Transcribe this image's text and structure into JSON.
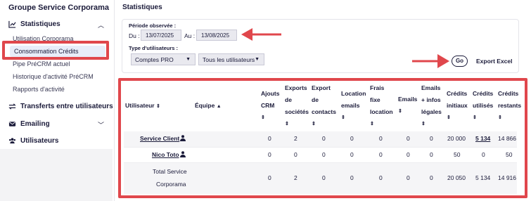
{
  "sidebar": {
    "brand": "Groupe Service Corporama",
    "sections": [
      {
        "label": "Statistiques",
        "icon": "chart-line-icon",
        "expanded": true
      },
      {
        "label": "Transferts entre utilisateurs",
        "icon": "swap-arrows-icon"
      },
      {
        "label": "Emailing",
        "icon": "envelope-icon",
        "expanded": false
      },
      {
        "label": "Utilisateurs",
        "icon": "users-icon"
      }
    ],
    "stats_items": [
      "Utilisation Corporama",
      "Consommation Crédits",
      "Pipe PréCRM actuel",
      "Historique d'activité PréCRM",
      "Rapports d'activité"
    ]
  },
  "main": {
    "title": "Statistiques",
    "period_label": "Période observée :",
    "from_label": "Du :",
    "from_value": "13/07/2025",
    "to_label": "Au :",
    "to_value": "13/08/2025",
    "user_type_label": "Type d'utilisateurs :",
    "user_type_value": "Comptes PRO",
    "users_value": "Tous les utilisateurs",
    "go_label": "Go",
    "excel_label": "Export Excel"
  },
  "table": {
    "headers": {
      "user": "Utilisateur",
      "team": "Équipe",
      "crm": [
        "Ajouts",
        "CRM"
      ],
      "exports_societes": [
        "Exports",
        "de",
        "sociétés"
      ],
      "exports_contacts": [
        "Export",
        "de",
        "contacts"
      ],
      "location_emails": [
        "Location",
        "emails"
      ],
      "frais_fixe": [
        "Frais",
        "fixe",
        "location"
      ],
      "emails": [
        "Emails"
      ],
      "emails_infos": [
        "Emails",
        "+ infos",
        "légales"
      ],
      "credits_initiaux": [
        "Crédits",
        "initiaux"
      ],
      "credits_utilises": [
        "Crédits",
        "utilisés"
      ],
      "credits_restants": [
        "Crédits",
        "restants"
      ]
    },
    "rows": [
      {
        "user": "Service Client",
        "values": [
          "0",
          "2",
          "0",
          "0",
          "0",
          "0",
          "0",
          "20 000",
          "5 134",
          "14 866"
        ]
      },
      {
        "user": "Nico Toto",
        "values": [
          "0",
          "0",
          "0",
          "0",
          "0",
          "0",
          "0",
          "50",
          "0",
          "50"
        ]
      }
    ],
    "total": {
      "label_line1": "Total Service",
      "label_line2": "Corporama",
      "values": [
        "0",
        "2",
        "0",
        "0",
        "0",
        "0",
        "0",
        "20 050",
        "5 134",
        "14 916"
      ]
    }
  },
  "colors": {
    "annotation_red": "#e0474c",
    "text_dark": "#1b1b3a",
    "active_bg": "#e8edf9"
  }
}
